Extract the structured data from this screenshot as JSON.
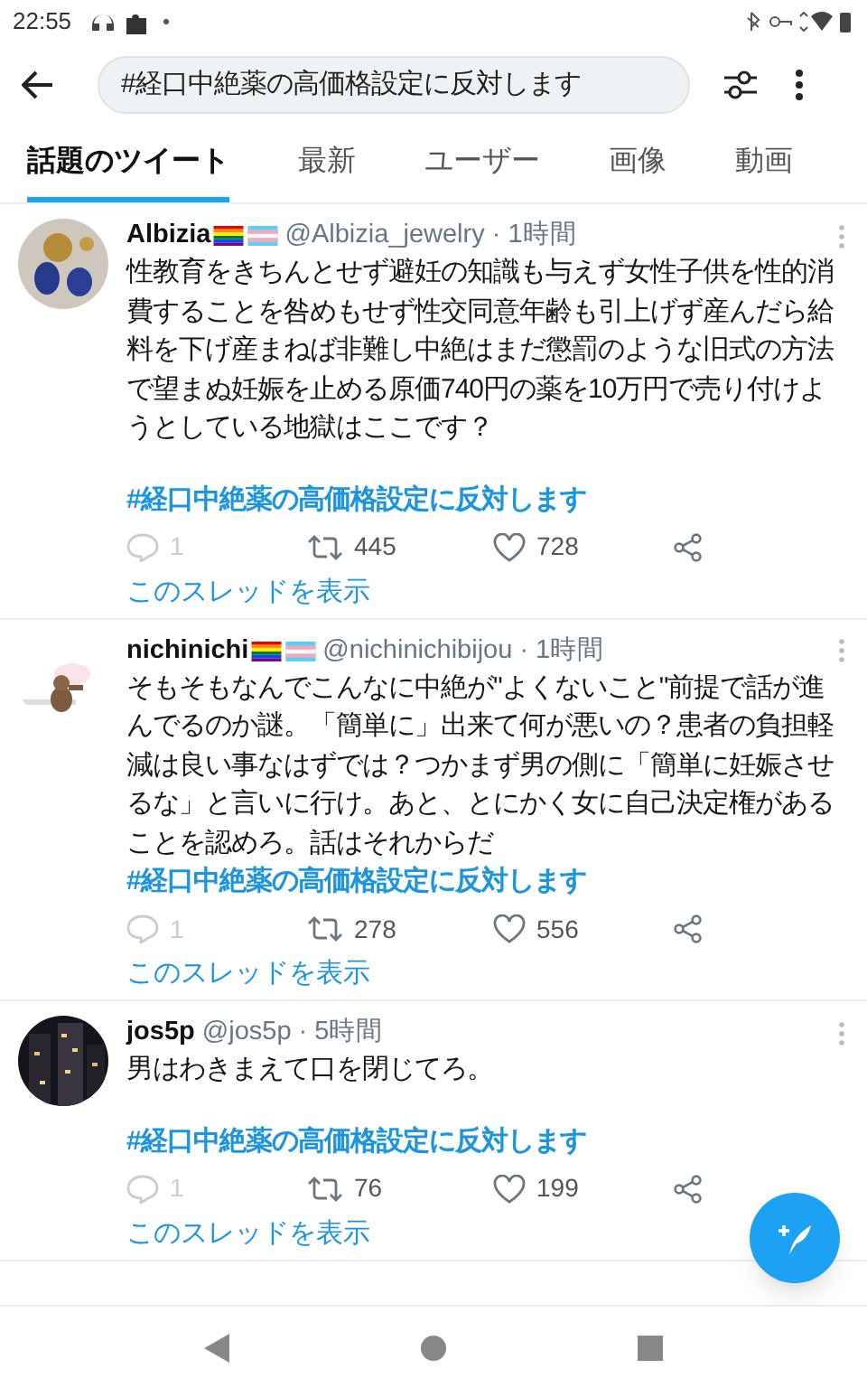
{
  "status_bar": {
    "time": "22:55"
  },
  "search": {
    "value": "#経口中絶薬の高価格設定に反対します"
  },
  "tabs": [
    {
      "label": "話題のツイート",
      "selected": true
    },
    {
      "label": "最新",
      "selected": false
    },
    {
      "label": "ユーザー",
      "selected": false
    },
    {
      "label": "画像",
      "selected": false
    },
    {
      "label": "動画",
      "selected": false
    }
  ],
  "tweets": [
    {
      "name": "Albizia",
      "flags": true,
      "handle": "@Albizia_jewelry",
      "time": "· 1時間",
      "body": "性教育をきちんとせず避妊の知識も与えず女性子供を性的消費することを咎めもせず性交同意年齢も引上げず産んだら給料を下げ産まねば非難し中絶はまだ懲罰のような旧式の方法で望まぬ妊娠を止める原価740円の薬を10万円で売り付けようとしている地獄はここです？",
      "spaced": true,
      "hashtag": "#経口中絶薬の高価格設定に反対します",
      "replies": "1",
      "retweets": "445",
      "likes": "728",
      "thread": "このスレッドを表示"
    },
    {
      "name": "nichinichi",
      "flags": true,
      "handle": "@nichinichibijou",
      "time": "· 1時間",
      "body": "そもそもなんでこんなに中絶が\"よくないこと\"前提で話が進んでるのか謎。「簡単に」出来て何が悪いの？患者の負担軽減は良い事なはずでは？つかまず男の側に「簡単に妊娠させるな」と言いに行け。あと、とにかく女に自己決定権があることを認めろ。話はそれからだ",
      "spaced": false,
      "hashtag": "#経口中絶薬の高価格設定に反対します",
      "replies": "1",
      "retweets": "278",
      "likes": "556",
      "thread": "このスレッドを表示"
    },
    {
      "name": "jos5p",
      "flags": false,
      "handle": "@jos5p",
      "time": "· 5時間",
      "body": "男はわきまえて口を閉じてろ。",
      "spaced": true,
      "hashtag": "#経口中絶薬の高価格設定に反対します",
      "replies": "1",
      "retweets": "76",
      "likes": "199",
      "thread": "このスレッドを表示"
    }
  ]
}
